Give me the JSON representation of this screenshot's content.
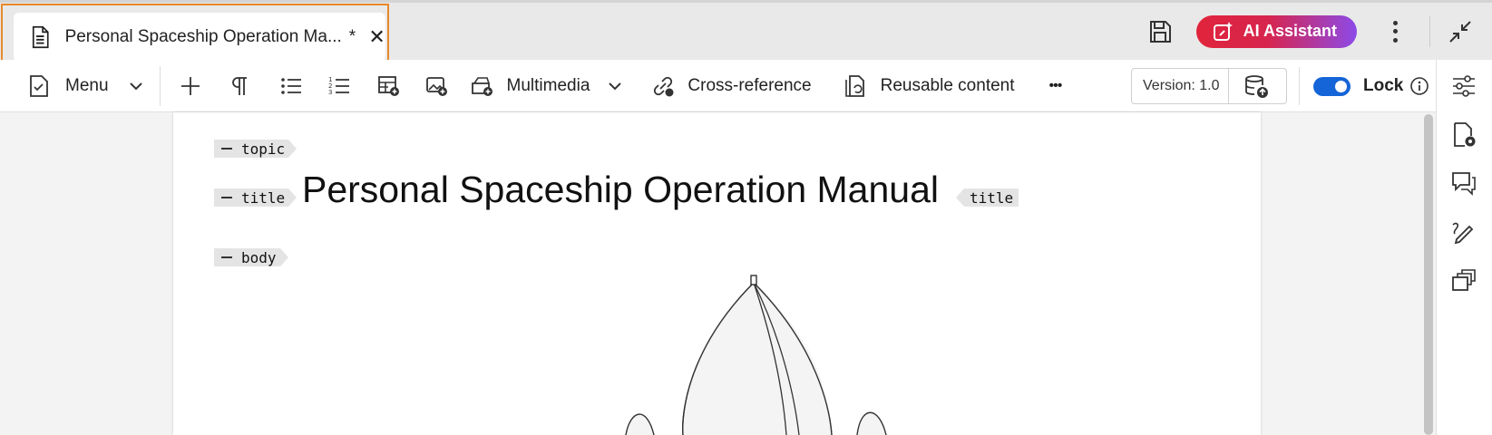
{
  "tab": {
    "title": "Personal Spaceship Operation Ma...",
    "modified_marker": "*",
    "close_glyph": "✕"
  },
  "header": {
    "ai_assistant_label": "AI Assistant",
    "ai_gradient": [
      "#e0243a",
      "#8c4ae8"
    ]
  },
  "toolbar": {
    "menu_label": "Menu",
    "multimedia_label": "Multimedia",
    "cross_reference_label": "Cross-reference",
    "reusable_content_label": "Reusable content",
    "more_glyph": "•••",
    "version_label": "Version: 1.0",
    "lock_label": "Lock",
    "lock_enabled": true,
    "accent_color": "#1565d8"
  },
  "document": {
    "tags": {
      "topic": "topic",
      "title_open": "title",
      "title_close": "title",
      "body": "body"
    },
    "title_text": "Personal Spaceship Operation Manual"
  },
  "colors": {
    "tab_highlight": "#e8892b",
    "tag_background": "#e4e4e4"
  },
  "rail": {
    "icons": [
      "sliders-icon",
      "file-settings-icon",
      "comments-icon",
      "pen-icon",
      "copies-icon"
    ]
  }
}
